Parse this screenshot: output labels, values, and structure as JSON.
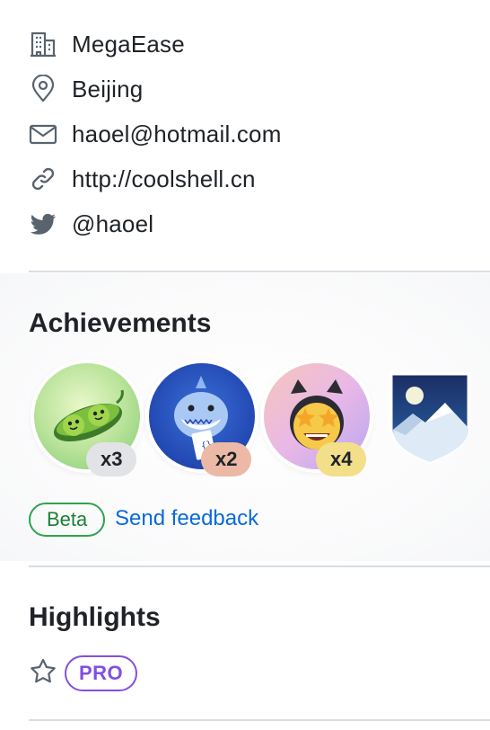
{
  "profile": {
    "details": [
      {
        "icon": "organization-icon",
        "text": "MegaEase"
      },
      {
        "icon": "location-icon",
        "text": "Beijing"
      },
      {
        "icon": "mail-icon",
        "text": "haoel@hotmail.com"
      },
      {
        "icon": "link-icon",
        "text": "http://coolshell.cn"
      },
      {
        "icon": "twitter-icon",
        "text": "@haoel"
      }
    ]
  },
  "achievements": {
    "title": "Achievements",
    "badges": [
      {
        "name": "pea-pod-badge",
        "count": "x3",
        "count_color": "#e1e3e6"
      },
      {
        "name": "shark-badge",
        "count": "x2",
        "count_color": "#ecb9a7"
      },
      {
        "name": "starstruck-badge",
        "count": "x4",
        "count_color": "#f3de8a"
      },
      {
        "name": "mountain-shield-badge",
        "count": ""
      }
    ],
    "beta_label": "Beta",
    "feedback_label": "Send feedback"
  },
  "highlights": {
    "title": "Highlights",
    "star_icon": "star-icon",
    "pro_label": "PRO"
  },
  "colors": {
    "text": "#1f2328",
    "muted_icon": "#59636e",
    "link": "#0969da",
    "beta_green": "#1a7f37",
    "pro_purple": "#8250df",
    "divider": "#d8dee4"
  }
}
